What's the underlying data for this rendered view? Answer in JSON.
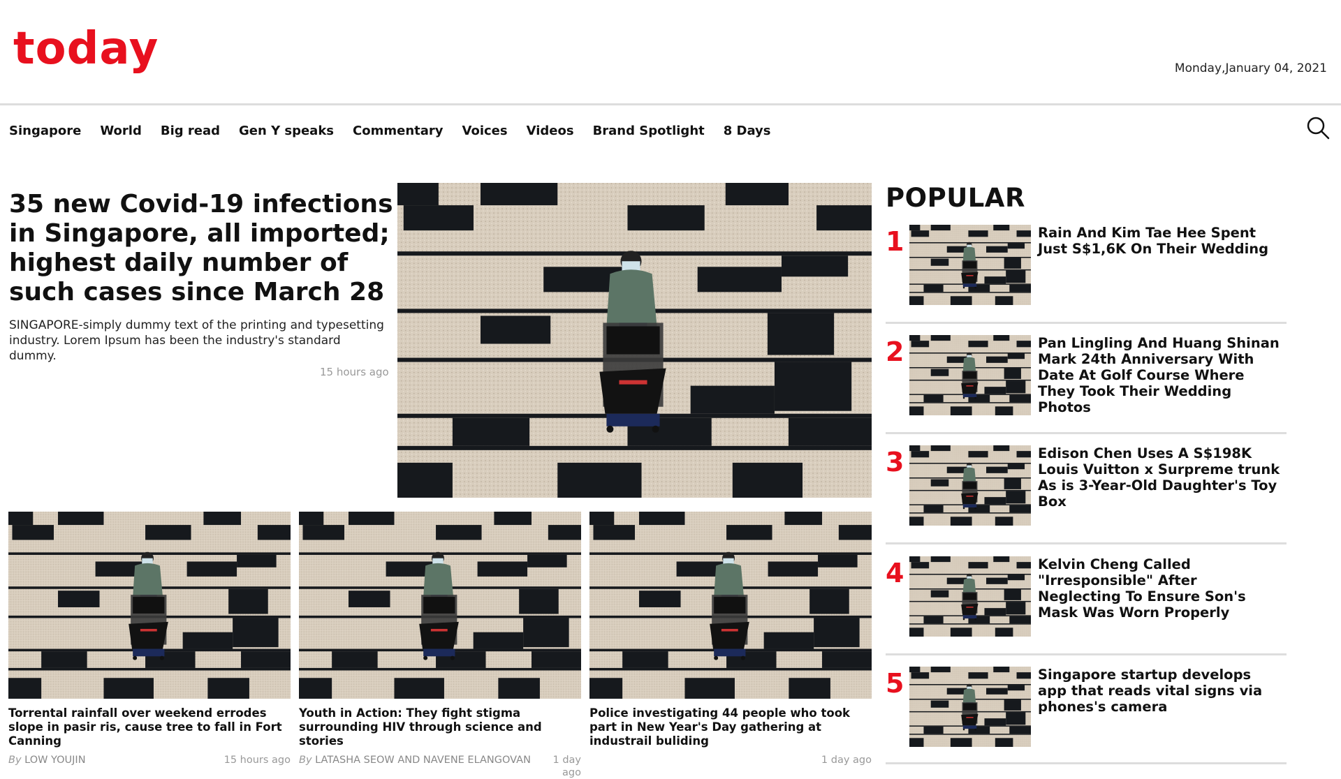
{
  "brand": {
    "logo": "today",
    "accent": "#e8101e"
  },
  "header": {
    "date": "Monday,January 04, 2021"
  },
  "nav": {
    "items": [
      "Singapore",
      "World",
      "Big read",
      "Gen Y speaks",
      "Commentary",
      "Voices",
      "Videos",
      "Brand Spotlight",
      "8 Days"
    ],
    "search_icon": "search-icon"
  },
  "lead": {
    "title": "35 new Covid-19 infections in Singapore, all imported; highest daily number of such cases since March 28",
    "description": "SINGAPORE-simply dummy text of the printing and typesetting industry. Lorem Ipsum has been the industry's standard dummy.",
    "time": "15 hours ago"
  },
  "cards": [
    {
      "title": "Torrental rainfall over weekend errodes slope in pasir ris, cause tree to fall in Fort Canning",
      "by": "By",
      "author": "LOW YOUJIN",
      "time": "15 hours ago"
    },
    {
      "title": "Youth in Action: They fight stigma surrounding HIV through science and stories",
      "by": "By",
      "author": "LATASHA SEOW AND NAVENE ELANGOVAN",
      "time": "1 day ago"
    },
    {
      "title": "Police investigating 44 people who took part in New Year's Day gathering at industrail buliding",
      "by": "",
      "author": "",
      "time": "1 day ago"
    }
  ],
  "popular": {
    "heading": "POPULAR",
    "items": [
      {
        "rank": "1",
        "title": "Rain And Kim Tae Hee Spent Just S$1,6K On Their Wedding"
      },
      {
        "rank": "2",
        "title": "Pan Lingling And Huang Shinan Mark 24th Anniversary With Date At Golf Course Where They Took Their Wedding Photos"
      },
      {
        "rank": "3",
        "title": "Edison Chen Uses A S$198K Louis Vuitton x Surpreme trunk As is 3-Year-Old Daughter's Toy Box"
      },
      {
        "rank": "4",
        "title": "Kelvin Cheng Called \"Irresponsible\" After Neglecting To Ensure Son's Mask Was Worn Properly"
      },
      {
        "rank": "5",
        "title": "Singapore startup develops app that reads vital signs via phones's camera"
      }
    ]
  }
}
